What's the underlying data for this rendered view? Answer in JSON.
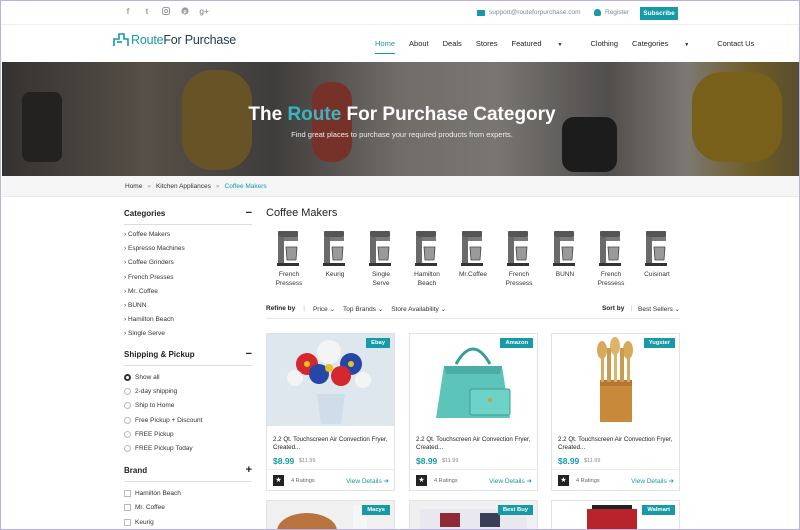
{
  "topbar": {
    "social": [
      "f",
      "t",
      "ig",
      "p",
      "g+"
    ],
    "email": "support@routeforpurchase.com",
    "register": "Register",
    "subscribe": "Subscribe"
  },
  "brand": {
    "name_a": "Route",
    "name_b": "For Purchase"
  },
  "nav": {
    "home": "Home",
    "about": "About",
    "deals": "Deals",
    "stores": "Stores",
    "featured": "Featured",
    "clothing": "Clothing",
    "categories": "Categories",
    "contact": "Contact Us"
  },
  "hero": {
    "title_a": "The",
    "title_accent": "Route",
    "title_b": "For Purchase Category",
    "subtitle": "Find great places to purchase your required products from experts."
  },
  "breadcrumb": [
    "Home",
    "Kitchen Appliances",
    "Coffee Makers"
  ],
  "sidebar": {
    "categories_title": "Categories",
    "categories": [
      "Coffee Makers",
      "Espresso Machines",
      "Coffee Grinders",
      "French Presses",
      "Mr. Coffee",
      "BUNN",
      "Hamilton Beach",
      "Single Serve"
    ],
    "shipping_title": "Shipping & Pickup",
    "shipping": [
      "Show all",
      "2-day shipping",
      "Ship to Home",
      "Free Pickup + Discount",
      "FREE Pickup",
      "FREE Pickup Today"
    ],
    "brand_title": "Brand",
    "brands": [
      "Hamilton Beach",
      "Mr. Coffee",
      "Keurig"
    ]
  },
  "content": {
    "title": "Coffee Makers",
    "makers": [
      {
        "line1": "French",
        "line2": "Pressess"
      },
      {
        "line1": "Keurig",
        "line2": ""
      },
      {
        "line1": "Single",
        "line2": "Serve"
      },
      {
        "line1": "Hamilton",
        "line2": "Beach"
      },
      {
        "line1": "Mr.Coffee",
        "line2": ""
      },
      {
        "line1": "French",
        "line2": "Pressess"
      },
      {
        "line1": "BUNN",
        "line2": ""
      },
      {
        "line1": "French",
        "line2": "Pressess"
      },
      {
        "line1": "Cuisinart",
        "line2": ""
      }
    ],
    "refine": {
      "label": "Refine by",
      "price": "Price",
      "brands": "Top Brands",
      "availability": "Store Availability",
      "sort_label": "Sort by",
      "sort_value": "Best Sellers"
    },
    "products": [
      {
        "store": "Ebay",
        "name": "2.2 Qt. Touchscreen Air Convection Fryer, Created...",
        "price": "$8.99",
        "old": "$11.99",
        "ratings": "4 Ratings",
        "view": "View Details"
      },
      {
        "store": "Amazon",
        "name": "2.2 Qt. Touchscreen Air Convection Fryer, Created...",
        "price": "$8.99",
        "old": "$11.99",
        "ratings": "4 Ratings",
        "view": "View Details"
      },
      {
        "store": "Yugster",
        "name": "2.2 Qt. Touchscreen Air Convection Fryer, Created...",
        "price": "$8.99",
        "old": "$11.99",
        "ratings": "4 Ratings",
        "view": "View Details"
      }
    ],
    "next_row": [
      "Macys",
      "Best Buy",
      "Walmart"
    ]
  },
  "colors": {
    "accent": "#1899a6",
    "dark": "#1b3c47"
  }
}
